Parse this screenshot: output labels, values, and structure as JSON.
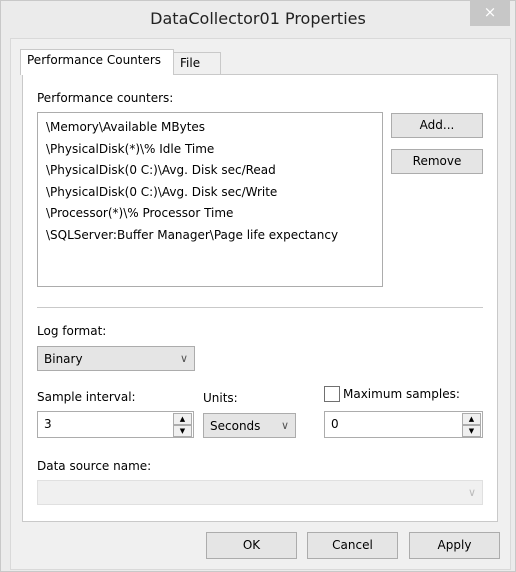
{
  "window": {
    "title": "DataCollector01 Properties",
    "close_icon": "×"
  },
  "tabs": [
    {
      "label": "Performance Counters",
      "active": true
    },
    {
      "label": "File",
      "active": false
    }
  ],
  "counters": {
    "label": "Performance counters:",
    "items": [
      "\\Memory\\Available MBytes",
      "\\PhysicalDisk(*)\\% Idle Time",
      "\\PhysicalDisk(0 C:)\\Avg. Disk sec/Read",
      "\\PhysicalDisk(0 C:)\\Avg. Disk sec/Write",
      "\\Processor(*)\\% Processor Time",
      "\\SQLServer:Buffer Manager\\Page life expectancy"
    ],
    "add_label": "Add...",
    "remove_label": "Remove"
  },
  "log_format": {
    "label": "Log format:",
    "value": "Binary"
  },
  "sample_interval": {
    "label": "Sample interval:",
    "value": "3"
  },
  "units": {
    "label": "Units:",
    "value": "Seconds"
  },
  "maximum_samples": {
    "label": "Maximum samples:",
    "checked": false,
    "value": "0"
  },
  "data_source": {
    "label": "Data source name:",
    "value": "",
    "disabled": true
  },
  "buttons": {
    "ok": "OK",
    "cancel": "Cancel",
    "apply": "Apply"
  }
}
